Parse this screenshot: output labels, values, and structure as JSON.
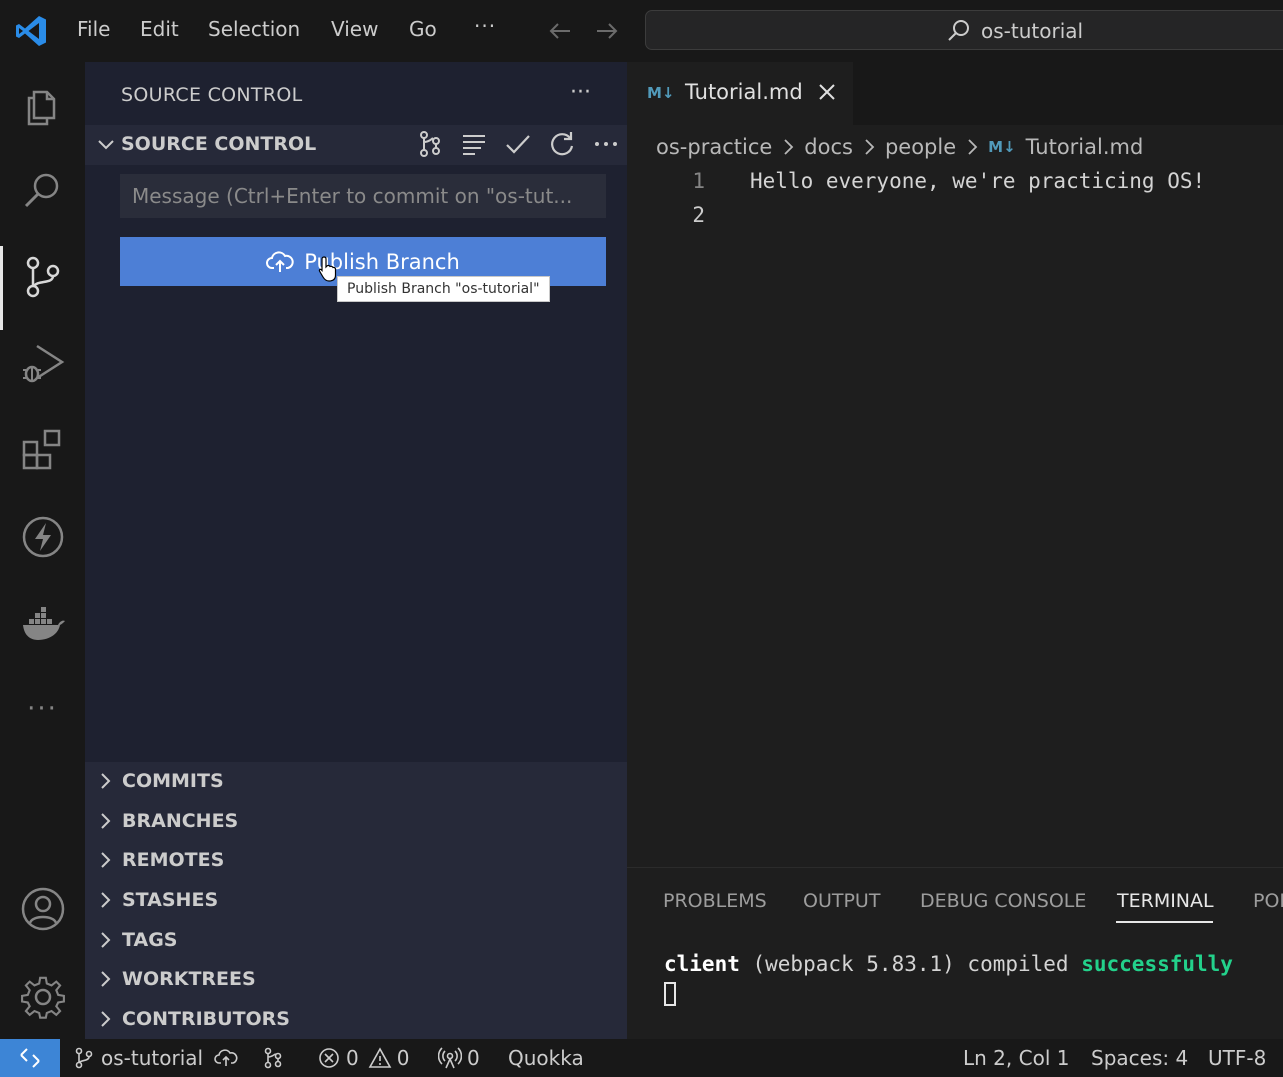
{
  "menu": [
    "File",
    "Edit",
    "Selection",
    "View",
    "Go"
  ],
  "command_center": {
    "text": "os-tutorial"
  },
  "sidebar": {
    "header": "SOURCE CONTROL",
    "section_title": "SOURCE CONTROL",
    "commit_placeholder": "Message (Ctrl+Enter to commit on \"os-tut...",
    "publish_label": "Publish Branch",
    "tooltip": "Publish Branch \"os-tutorial\"",
    "panels": [
      "COMMITS",
      "BRANCHES",
      "REMOTES",
      "STASHES",
      "TAGS",
      "WORKTREES",
      "CONTRIBUTORS"
    ]
  },
  "editor": {
    "tab_label": "Tutorial.md",
    "tab_icon": "M↓",
    "breadcrumbs": [
      "os-practice",
      "docs",
      "people",
      "Tutorial.md"
    ],
    "lines": [
      {
        "num": "1",
        "text": "Hello everyone, we're practicing OS!"
      },
      {
        "num": "2",
        "text": ""
      }
    ]
  },
  "panel": {
    "tabs": [
      "PROBLEMS",
      "OUTPUT",
      "DEBUG CONSOLE",
      "TERMINAL",
      "POI"
    ],
    "terminal": {
      "word1": "client",
      "middle": " (webpack 5.83.1) compiled ",
      "word2": "successfully"
    }
  },
  "status": {
    "branch": "os-tutorial",
    "errors": "0",
    "warnings": "0",
    "ports": "0",
    "quokka": "Quokka",
    "position": "Ln 2, Col 1",
    "spaces": "Spaces: 4",
    "encoding": "UTF-8"
  },
  "colors": {
    "accent": "#4d7fd6",
    "remote": "#3d85d6",
    "success": "#23d18b"
  }
}
